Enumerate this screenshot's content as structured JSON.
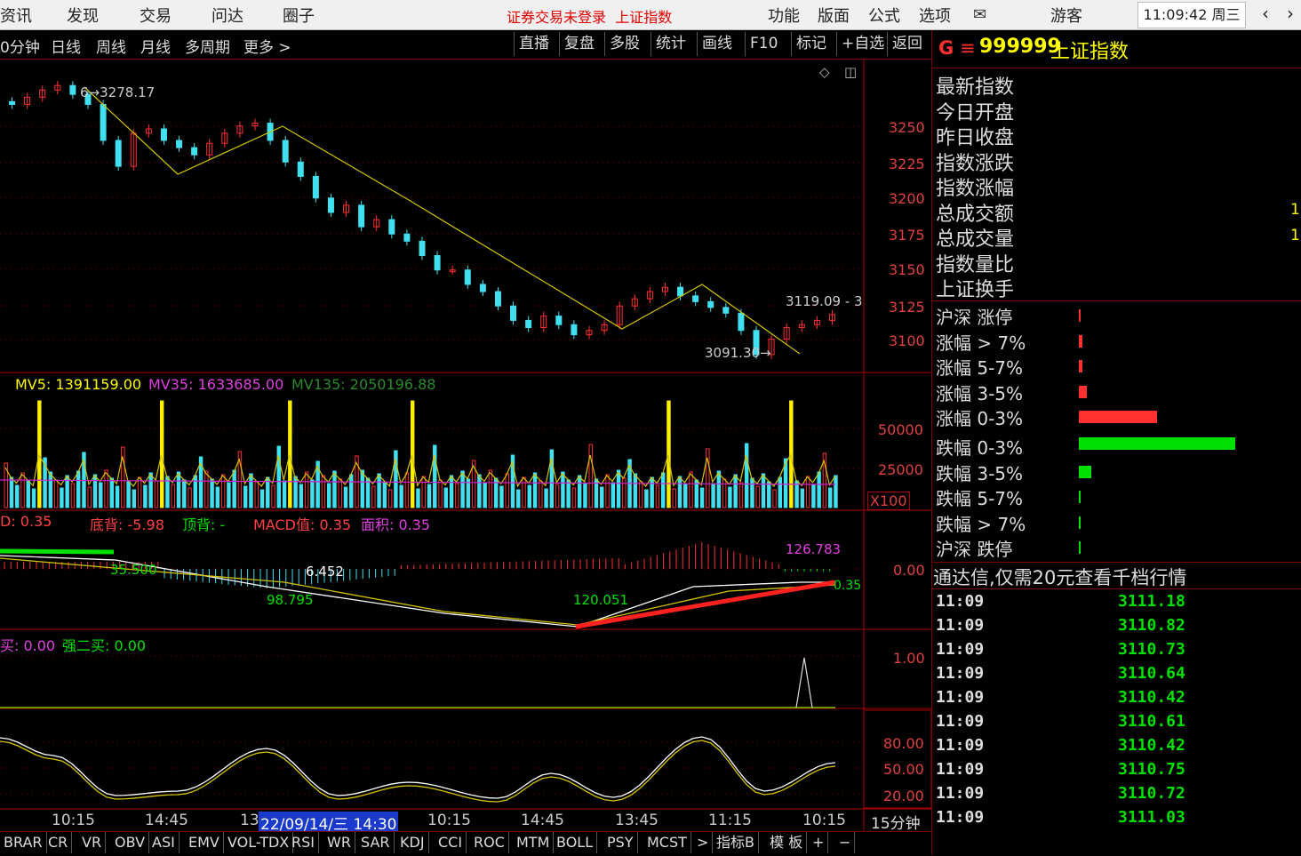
{
  "menu": [
    "资讯",
    "发现",
    "交易",
    "问达",
    "圈子"
  ],
  "title_status": "证券交易未登录",
  "title_index": "上证指数",
  "menu_right": [
    "功能",
    "版面",
    "公式",
    "选项"
  ],
  "guest": "游客",
  "clock": "11:09:42 周三",
  "periods": [
    "0分钟",
    "日线",
    "周线",
    "月线",
    "多周期",
    "更多 >"
  ],
  "toolbar": [
    "直播",
    "复盘",
    "多股",
    "统计",
    "画线",
    "F10",
    "标记",
    "+自选",
    "返回"
  ],
  "stock": {
    "badge": "G",
    "code": "999999",
    "name": "上证指数"
  },
  "quote_labels": [
    "最新指数",
    "今日开盘",
    "昨日收盘",
    "指数涨跌",
    "指数涨幅",
    "总成交额",
    "总成交量",
    "指数量比",
    "上证换手"
  ],
  "quote_values_partial": [
    "1",
    "1"
  ],
  "breadth": [
    {
      "label": "沪深 涨停",
      "bar": 0.01,
      "color": "#ff3030"
    },
    {
      "label": "涨幅 > 7%",
      "bar": 0.02,
      "color": "#ff3030"
    },
    {
      "label": "涨幅 5-7%",
      "bar": 0.02,
      "color": "#ff3030"
    },
    {
      "label": "涨幅 3-5%",
      "bar": 0.05,
      "color": "#ff3030"
    },
    {
      "label": "涨幅 0-3%",
      "bar": 0.5,
      "color": "#ff3030"
    },
    {
      "label": "跌幅 0-3%",
      "bar": 1.0,
      "color": "#00e000"
    },
    {
      "label": "跌幅 3-5%",
      "bar": 0.08,
      "color": "#00e000"
    },
    {
      "label": "跌幅 5-7%",
      "bar": 0.01,
      "color": "#00e000"
    },
    {
      "label": "跌幅 > 7%",
      "bar": 0.01,
      "color": "#00e000"
    },
    {
      "label": "沪深 跌停",
      "bar": 0.01,
      "color": "#00e000"
    }
  ],
  "promo": "通达信,仅需20元查看千档行情",
  "ticks": [
    {
      "t": "11:09",
      "v": "3111.18"
    },
    {
      "t": "11:09",
      "v": "3110.82"
    },
    {
      "t": "11:09",
      "v": "3110.73"
    },
    {
      "t": "11:09",
      "v": "3110.64"
    },
    {
      "t": "11:09",
      "v": "3110.42"
    },
    {
      "t": "11:09",
      "v": "3110.61"
    },
    {
      "t": "11:09",
      "v": "3110.42"
    },
    {
      "t": "11:09",
      "v": "3110.75"
    },
    {
      "t": "11:09",
      "v": "3110.72"
    },
    {
      "t": "11:09",
      "v": "3111.03"
    }
  ],
  "price_axis": [
    "3250",
    "3225",
    "3200",
    "3175",
    "3150",
    "3125",
    "3100"
  ],
  "price_annotations": {
    "high": "3278.17",
    "low": "3091.30",
    "last": "3119.09 - 3"
  },
  "vol_legend": {
    "mv5": "MV5: 1391159.00",
    "mv35": "MV35: 1633685.00",
    "mv135": "MV135: 2050196.88"
  },
  "vol_axis": [
    "50000",
    "25000"
  ],
  "vol_unit": "X100",
  "macd_legend": {
    "a": "D: 0.35",
    "b": "底背: -5.98",
    "c": "顶背: -",
    "d": "MACD值: 0.35",
    "e": "面积: 0.35"
  },
  "macd_axis": "0.00",
  "macd_annots": [
    "35.500",
    "6.452",
    "98.795",
    "120.051",
    "126.783",
    "0.35"
  ],
  "buy_legend": {
    "a": "买: 0.00",
    "b": "强二买: 0.00"
  },
  "buy_axis": "1.00",
  "osc_axis": [
    "80.00",
    "50.00",
    "20.00"
  ],
  "xaxis": [
    "10:15",
    "14:45",
    "13",
    "22/09/14/三 14:30",
    "10:15",
    "14:45",
    "13:45",
    "11:15",
    "10:15"
  ],
  "period_label": "15分钟",
  "bottom_tabs": [
    "BRAR",
    "CR",
    "VR",
    "OBV",
    "ASI",
    "EMV",
    "VOL-TDX",
    "RSI",
    "WR",
    "SAR",
    "KDJ",
    "CCI",
    "ROC",
    "MTM",
    "BOLL",
    "PSY",
    "MCST",
    ">",
    "指标B",
    "模 板",
    "+",
    "−"
  ],
  "chart_data": {
    "type": "candlestick",
    "series": [
      {
        "values": [
          3265,
          3270,
          3275,
          3278.17,
          3272,
          3265,
          3240,
          3222,
          3245,
          3248,
          3240,
          3235,
          3230,
          3238,
          3245,
          3250,
          3252,
          3240,
          3225,
          3215,
          3200,
          3190,
          3195,
          3180,
          3185,
          3175,
          3170,
          3160,
          3150,
          3150,
          3140,
          3135,
          3125,
          3115,
          3110,
          3118,
          3112,
          3105,
          3108,
          3112,
          3125,
          3130,
          3135,
          3138,
          3132,
          3128,
          3124,
          3120,
          3108,
          3091.3,
          3102,
          3110,
          3112,
          3115,
          3119.09
        ]
      }
    ],
    "ylim": [
      3085,
      3290
    ]
  }
}
